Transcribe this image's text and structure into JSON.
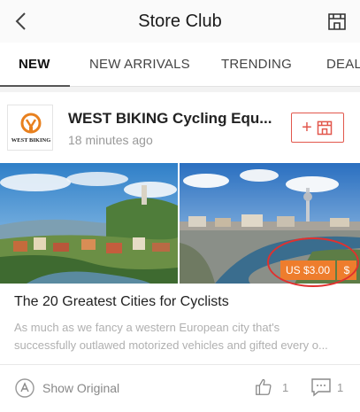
{
  "header": {
    "title": "Store Club",
    "back_icon": "chevron-left-icon",
    "store_icon": "storefront-icon"
  },
  "tabs": [
    {
      "label": "NEW",
      "active": true
    },
    {
      "label": "NEW ARRIVALS",
      "active": false
    },
    {
      "label": "TRENDING",
      "active": false
    },
    {
      "label": "DEAL",
      "active": false
    }
  ],
  "post": {
    "store_name": "WEST BIKING Cycling Equ...",
    "logo_text": "WEST BIKING",
    "posted_time": "18 minutes ago",
    "follow_icon": "plus-store-icon",
    "price": "US $3.00",
    "price_currency": "$",
    "title": "The 20 Greatest Cities for Cyclists",
    "description_line1": "As much as we fancy a western European city that's",
    "description_line2": "successfully outlawed motorized vehicles and gifted every o...",
    "show_original_label": "Show Original",
    "like_count": "1",
    "comment_count": "1"
  },
  "colors": {
    "accent": "#e2574c",
    "price_tag": "#ee7d2d",
    "annotation_circle": "#e0312f"
  }
}
